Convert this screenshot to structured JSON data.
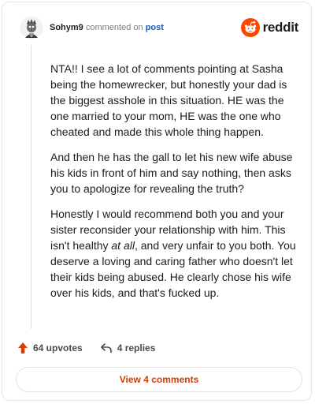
{
  "comment": {
    "username": "Sohym9",
    "action_text": "commented on",
    "post_link": "post",
    "paragraphs": [
      {
        "text": "NTA!! I see a lot of comments pointing at Sasha being the homewrecker, but honestly your dad is the biggest asshole in this situation. HE was the one married to your mom, HE was the one who cheated and made this whole thing happen."
      },
      {
        "text": "And then he has the gall to let his new wife abuse his kids in front of him and say nothing, then asks you to apologize for revealing the truth?"
      },
      {
        "before": "Honestly I would recommend both you and your sister reconsider your relationship with him. This isn't healthy ",
        "emphasis": "at all",
        "after": ", and very unfair to you both. You deserve a loving and caring father who doesn't let their kids being abused. He clearly chose his wife over his kids, and that's fucked up."
      }
    ]
  },
  "brand": {
    "wordmark": "reddit",
    "accent": "#ff4500"
  },
  "actions": {
    "upvotes_label": "64 upvotes",
    "replies_label": "4 replies"
  },
  "footer": {
    "view_comments_label": "View 4 comments"
  },
  "icons": {
    "avatar": "avatar-icon",
    "brand": "reddit-logo-icon",
    "upvote": "upvote-arrow-icon",
    "reply": "reply-arrow-icon"
  }
}
